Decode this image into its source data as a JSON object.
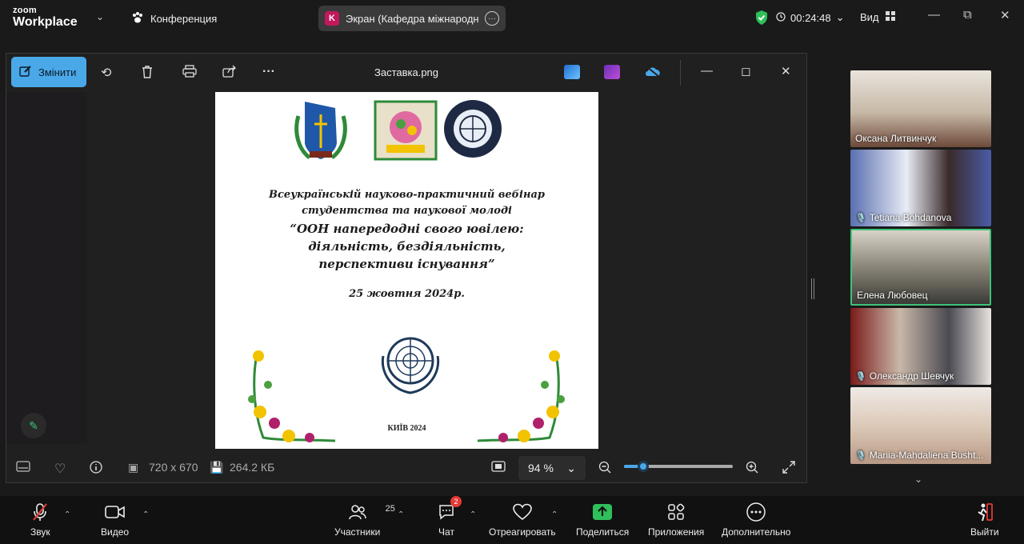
{
  "topbar": {
    "brand_line1": "zoom",
    "brand_line2": "Workplace",
    "meeting_label": "Конференция",
    "share_badge": "K",
    "share_title": "Экран (Кафедра міжнародних в",
    "timer": "00:24:48",
    "view_label": "Вид"
  },
  "viewer": {
    "edit_label": "Змінити",
    "file_name": "Заставка.png",
    "image": {
      "line1": "Всеукраїнській науково-практичний вебінар",
      "line2": "студентства  та наукової молоді",
      "line3": "“ООН напередодні свого ювілею:",
      "line4": "діяльність, бездіяльність,",
      "line5": "перспективи існування”",
      "date": "25 жовтня 2024р.",
      "footer": "КИЇВ 2024"
    },
    "status": {
      "dimensions": "720 x 670",
      "file_size": "264.2 КБ",
      "zoom": "94 %",
      "zoom_level": 0.18
    }
  },
  "participants": [
    {
      "name": "Оксана Литвинчук",
      "muted": false,
      "active": false
    },
    {
      "name": "Tetiana Bohdanova",
      "muted": true,
      "active": false
    },
    {
      "name": "Елена Любовец",
      "muted": false,
      "active": true
    },
    {
      "name": "Олександр Шевчук",
      "muted": true,
      "active": false
    },
    {
      "name": "Mariia-Mahdaliena Busht...",
      "muted": true,
      "active": false
    }
  ],
  "bottombar": {
    "audio": "Звук",
    "video": "Видео",
    "participants": "Участники",
    "participants_count": "25",
    "chat": "Чат",
    "chat_badge": "2",
    "react": "Отреагировать",
    "share": "Поделиться",
    "apps": "Приложения",
    "more": "Дополнительно",
    "leave": "Выйти"
  },
  "colors": {
    "accent": "#4aa8e8",
    "active_speaker": "#3fc27a",
    "share_green": "#2fbf5b",
    "muted_red": "#e53935"
  }
}
